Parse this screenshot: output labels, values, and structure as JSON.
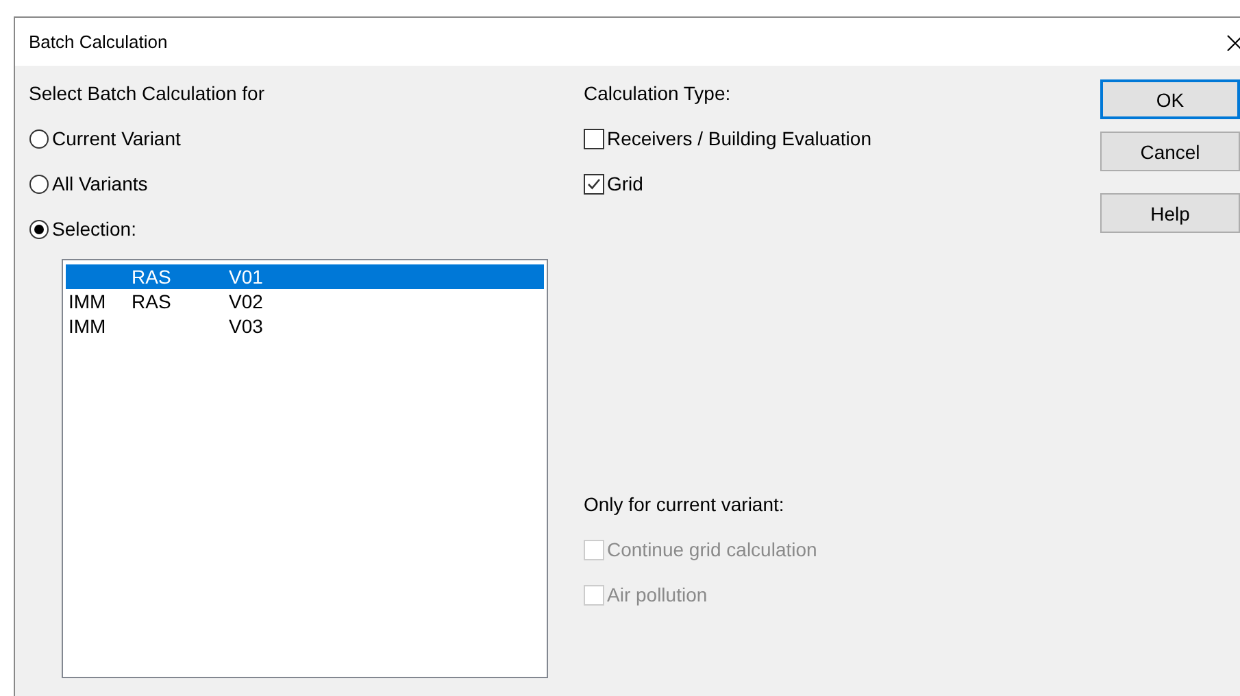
{
  "window": {
    "title": "Batch Calculation"
  },
  "scope": {
    "label": "Select Batch Calculation for",
    "options": [
      {
        "label": "Current Variant",
        "selected": false
      },
      {
        "label": "All Variants",
        "selected": false
      },
      {
        "label": "Selection:",
        "selected": true
      }
    ]
  },
  "selection_list": [
    {
      "cells": [
        "",
        "RAS",
        "V01"
      ],
      "selected": true
    },
    {
      "cells": [
        "IMM",
        "RAS",
        "V02"
      ],
      "selected": false
    },
    {
      "cells": [
        "IMM",
        "",
        "V03"
      ],
      "selected": false
    }
  ],
  "calculation_type": {
    "label": "Calculation Type:",
    "options": [
      {
        "label": "Receivers / Building Evaluation",
        "checked": false,
        "disabled": false
      },
      {
        "label": "Grid",
        "checked": true,
        "disabled": false
      }
    ]
  },
  "current_variant_only": {
    "label": "Only for current variant:",
    "options": [
      {
        "label": "Continue grid calculation",
        "checked": false,
        "disabled": true
      },
      {
        "label": "Air pollution",
        "checked": false,
        "disabled": true
      }
    ]
  },
  "buttons": [
    {
      "label": "OK",
      "default": true
    },
    {
      "label": "Cancel",
      "default": false
    },
    {
      "label": "Help",
      "default": false
    }
  ]
}
